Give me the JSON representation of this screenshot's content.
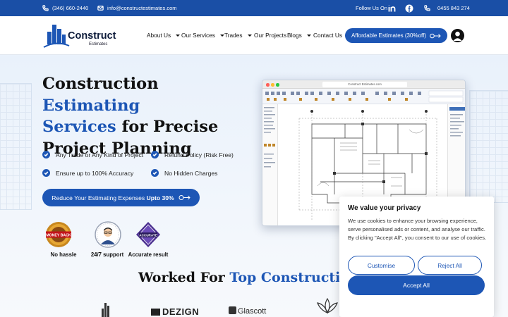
{
  "topbar": {
    "phone": "(346) 660-2440",
    "email": "info@constructestimates.com",
    "follow_label": "Follow Us On",
    "phone_alt": "0455 843 274"
  },
  "logo": {
    "name": "Construct",
    "sub": "Estimates"
  },
  "nav": {
    "items": [
      {
        "label": "About Us",
        "dropdown": true
      },
      {
        "label": "Our Services",
        "dropdown": true
      },
      {
        "label": "Trades",
        "dropdown": true
      },
      {
        "label": "Our Projects",
        "dropdown": false
      },
      {
        "label": "Blogs",
        "dropdown": true
      },
      {
        "label": "Contact Us",
        "dropdown": false
      }
    ],
    "cta_label": "Affordable Estimates (30%off)"
  },
  "hero": {
    "title_part1": "Construction ",
    "title_part2": "Estimating",
    "title_part3": "Services",
    "title_part4": " for Precise",
    "title_part5": "Project Planning",
    "features": [
      "Any Trade or Any Kind of Project",
      "Refund Policy (Risk Free)",
      "Ensure up to 100% Accuracy",
      "No Hidden Charges"
    ],
    "cta_prefix": "Reduce Your Estimating Expenses ",
    "cta_bold": "Upto 30%",
    "badges": [
      {
        "label": "No hassle",
        "text": "MONEY BACK"
      },
      {
        "label": "24/7 support",
        "text": ""
      },
      {
        "label": "Accurate result",
        "text": "ACCURATE"
      }
    ],
    "window_url": "Construct Estimates.com"
  },
  "worked": {
    "part1": "Worked For ",
    "part2": "Top Construction Br"
  },
  "brands": [
    "DEZIGN",
    "Glascott"
  ],
  "cookie": {
    "title": "We value your privacy",
    "body": "We use cookies to enhance your browsing experience, serve personalised ads or content, and analyse our traffic. By clicking \"Accept All\", you consent to our use of cookies.",
    "customise": "Customise",
    "reject": "Reject All",
    "accept": "Accept All"
  },
  "colors": {
    "brand": "#1d56b5",
    "topbar": "#1a4fa6",
    "text": "#111111"
  }
}
